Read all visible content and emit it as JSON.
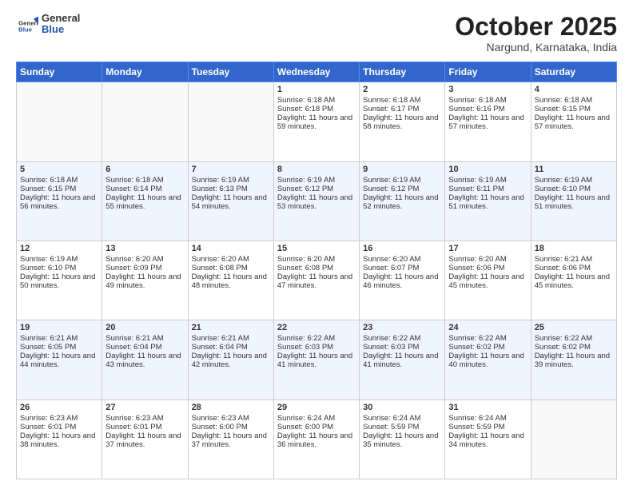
{
  "logo": {
    "general": "General",
    "blue": "Blue"
  },
  "header": {
    "month": "October 2025",
    "location": "Nargund, Karnataka, India"
  },
  "weekdays": [
    "Sunday",
    "Monday",
    "Tuesday",
    "Wednesday",
    "Thursday",
    "Friday",
    "Saturday"
  ],
  "weeks": [
    [
      {
        "day": "",
        "info": ""
      },
      {
        "day": "",
        "info": ""
      },
      {
        "day": "",
        "info": ""
      },
      {
        "day": "1",
        "info": "Sunrise: 6:18 AM\nSunset: 6:18 PM\nDaylight: 11 hours and 59 minutes."
      },
      {
        "day": "2",
        "info": "Sunrise: 6:18 AM\nSunset: 6:17 PM\nDaylight: 11 hours and 58 minutes."
      },
      {
        "day": "3",
        "info": "Sunrise: 6:18 AM\nSunset: 6:16 PM\nDaylight: 11 hours and 57 minutes."
      },
      {
        "day": "4",
        "info": "Sunrise: 6:18 AM\nSunset: 6:15 PM\nDaylight: 11 hours and 57 minutes."
      }
    ],
    [
      {
        "day": "5",
        "info": "Sunrise: 6:18 AM\nSunset: 6:15 PM\nDaylight: 11 hours and 56 minutes."
      },
      {
        "day": "6",
        "info": "Sunrise: 6:18 AM\nSunset: 6:14 PM\nDaylight: 11 hours and 55 minutes."
      },
      {
        "day": "7",
        "info": "Sunrise: 6:19 AM\nSunset: 6:13 PM\nDaylight: 11 hours and 54 minutes."
      },
      {
        "day": "8",
        "info": "Sunrise: 6:19 AM\nSunset: 6:12 PM\nDaylight: 11 hours and 53 minutes."
      },
      {
        "day": "9",
        "info": "Sunrise: 6:19 AM\nSunset: 6:12 PM\nDaylight: 11 hours and 52 minutes."
      },
      {
        "day": "10",
        "info": "Sunrise: 6:19 AM\nSunset: 6:11 PM\nDaylight: 11 hours and 51 minutes."
      },
      {
        "day": "11",
        "info": "Sunrise: 6:19 AM\nSunset: 6:10 PM\nDaylight: 11 hours and 51 minutes."
      }
    ],
    [
      {
        "day": "12",
        "info": "Sunrise: 6:19 AM\nSunset: 6:10 PM\nDaylight: 11 hours and 50 minutes."
      },
      {
        "day": "13",
        "info": "Sunrise: 6:20 AM\nSunset: 6:09 PM\nDaylight: 11 hours and 49 minutes."
      },
      {
        "day": "14",
        "info": "Sunrise: 6:20 AM\nSunset: 6:08 PM\nDaylight: 11 hours and 48 minutes."
      },
      {
        "day": "15",
        "info": "Sunrise: 6:20 AM\nSunset: 6:08 PM\nDaylight: 11 hours and 47 minutes."
      },
      {
        "day": "16",
        "info": "Sunrise: 6:20 AM\nSunset: 6:07 PM\nDaylight: 11 hours and 46 minutes."
      },
      {
        "day": "17",
        "info": "Sunrise: 6:20 AM\nSunset: 6:06 PM\nDaylight: 11 hours and 45 minutes."
      },
      {
        "day": "18",
        "info": "Sunrise: 6:21 AM\nSunset: 6:06 PM\nDaylight: 11 hours and 45 minutes."
      }
    ],
    [
      {
        "day": "19",
        "info": "Sunrise: 6:21 AM\nSunset: 6:05 PM\nDaylight: 11 hours and 44 minutes."
      },
      {
        "day": "20",
        "info": "Sunrise: 6:21 AM\nSunset: 6:04 PM\nDaylight: 11 hours and 43 minutes."
      },
      {
        "day": "21",
        "info": "Sunrise: 6:21 AM\nSunset: 6:04 PM\nDaylight: 11 hours and 42 minutes."
      },
      {
        "day": "22",
        "info": "Sunrise: 6:22 AM\nSunset: 6:03 PM\nDaylight: 11 hours and 41 minutes."
      },
      {
        "day": "23",
        "info": "Sunrise: 6:22 AM\nSunset: 6:03 PM\nDaylight: 11 hours and 41 minutes."
      },
      {
        "day": "24",
        "info": "Sunrise: 6:22 AM\nSunset: 6:02 PM\nDaylight: 11 hours and 40 minutes."
      },
      {
        "day": "25",
        "info": "Sunrise: 6:22 AM\nSunset: 6:02 PM\nDaylight: 11 hours and 39 minutes."
      }
    ],
    [
      {
        "day": "26",
        "info": "Sunrise: 6:23 AM\nSunset: 6:01 PM\nDaylight: 11 hours and 38 minutes."
      },
      {
        "day": "27",
        "info": "Sunrise: 6:23 AM\nSunset: 6:01 PM\nDaylight: 11 hours and 37 minutes."
      },
      {
        "day": "28",
        "info": "Sunrise: 6:23 AM\nSunset: 6:00 PM\nDaylight: 11 hours and 37 minutes."
      },
      {
        "day": "29",
        "info": "Sunrise: 6:24 AM\nSunset: 6:00 PM\nDaylight: 11 hours and 36 minutes."
      },
      {
        "day": "30",
        "info": "Sunrise: 6:24 AM\nSunset: 5:59 PM\nDaylight: 11 hours and 35 minutes."
      },
      {
        "day": "31",
        "info": "Sunrise: 6:24 AM\nSunset: 5:59 PM\nDaylight: 11 hours and 34 minutes."
      },
      {
        "day": "",
        "info": ""
      }
    ]
  ]
}
